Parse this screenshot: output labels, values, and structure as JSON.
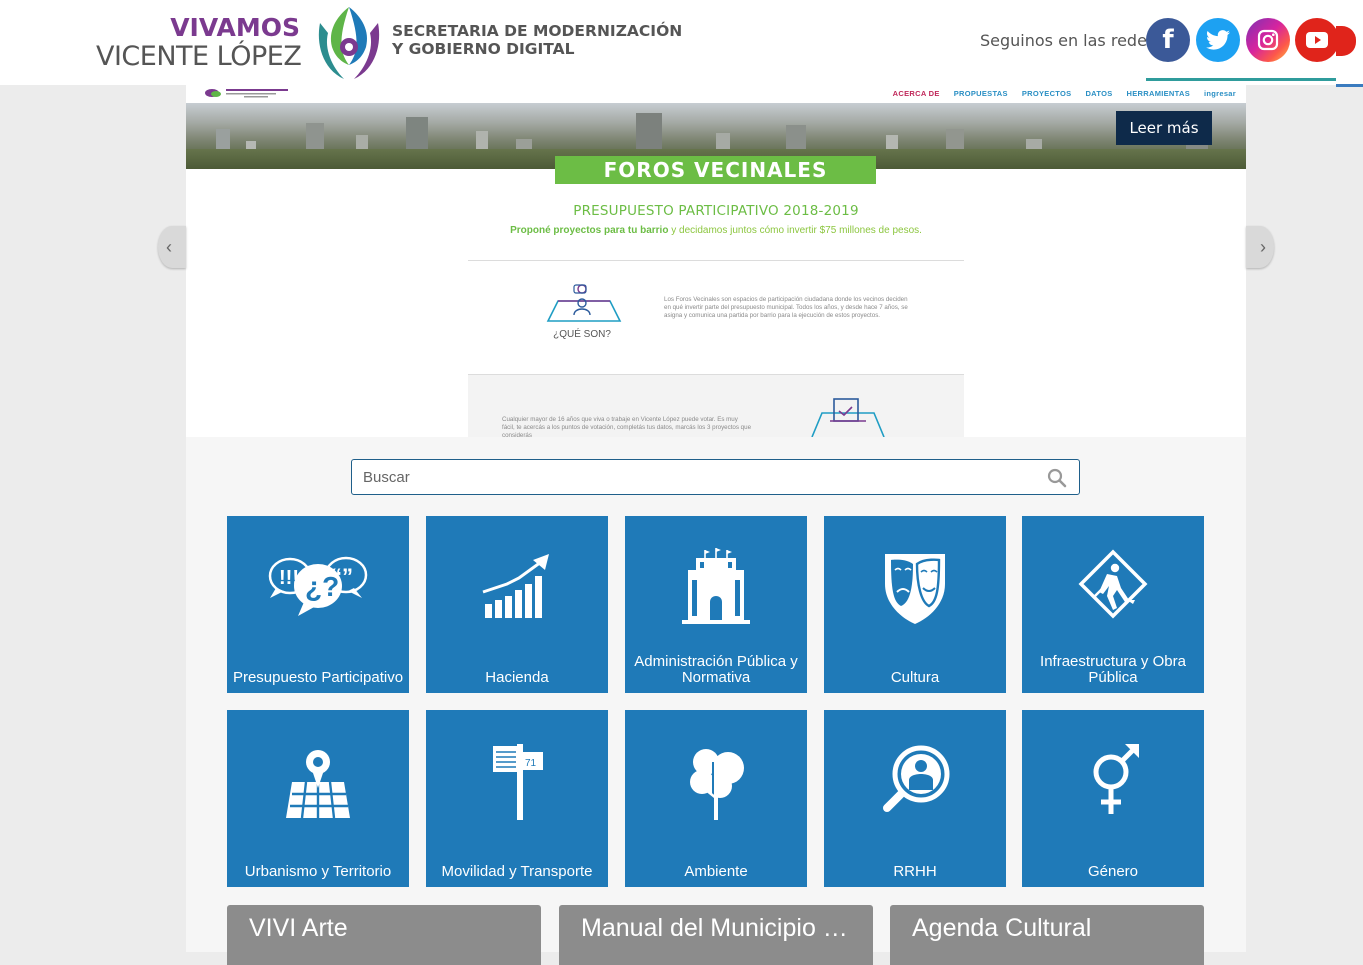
{
  "header": {
    "logo_line1": "VIVAMOS",
    "logo_line2": "VICENTE LÓPEZ",
    "secretaria_line1": "SECRETARIA DE MODERNIZACIÓN",
    "secretaria_line2": "Y GOBIERNO DIGITAL",
    "redes_label": "Seguinos en las redes",
    "social": [
      {
        "name": "facebook",
        "icon": "facebook-icon",
        "color": "#3b5998"
      },
      {
        "name": "twitter",
        "icon": "twitter-icon",
        "color": "#1da1f2"
      },
      {
        "name": "instagram",
        "icon": "instagram-icon",
        "color": "#d6249f"
      },
      {
        "name": "youtube",
        "icon": "youtube-icon",
        "color": "#e0241b"
      }
    ]
  },
  "carousel": {
    "mini_nav": [
      "ACERCA DE",
      "PROPUESTAS",
      "PROYECTOS",
      "DATOS",
      "HERRAMIENTAS",
      "ingresar"
    ],
    "leer_mas": "Leer más",
    "banner_title": "FOROS VECINALES",
    "headline": "PRESUPUESTO PARTICIPATIVO 2018-2019",
    "sub_bold": "Proponé proyectos para tu barrio",
    "sub_rest": " y decidamos juntos cómo invertir $75 millones de pesos.",
    "que_son_label": "¿QUÉ SON?",
    "que_son_text": "Los Foros Vecinales son espacios de participación ciudadana donde los vecinos deciden en qué invertir parte del presupuesto municipal. Todos los años, y desde hace 7 años, se asigna y comunica una partida por barrio para la ejecución de estos proyectos.",
    "voto_text": "Cualquier mayor de 16 años que viva o trabaje en Vicente López puede votar. Es muy fácil, te acercás a los puntos de votación, completás tus datos, marcás los 3 proyectos que considerás"
  },
  "search": {
    "placeholder": "Buscar"
  },
  "tiles": [
    {
      "label": "Presupuesto Participativo",
      "icon": "speech-bubbles-icon"
    },
    {
      "label": "Hacienda",
      "icon": "growth-chart-icon"
    },
    {
      "label": "Administración Pública y Normativa",
      "icon": "government-building-icon"
    },
    {
      "label": "Cultura",
      "icon": "theater-masks-icon"
    },
    {
      "label": "Infraestructura y Obra Pública",
      "icon": "road-work-sign-icon"
    },
    {
      "label": "Urbanismo y Territorio",
      "icon": "map-pin-icon"
    },
    {
      "label": "Movilidad y Transporte",
      "icon": "street-sign-icon"
    },
    {
      "label": "Ambiente",
      "icon": "tree-icon"
    },
    {
      "label": "RRHH",
      "icon": "person-magnifier-icon"
    },
    {
      "label": "Género",
      "icon": "gender-symbol-icon"
    }
  ],
  "bottom_cards": [
    {
      "label": "VIVI Arte"
    },
    {
      "label": "Manual del Municipio de Vicente López"
    },
    {
      "label": "Agenda Cultural"
    }
  ],
  "colors": {
    "tile_blue": "#1f7ab8",
    "brand_purple": "#7b3a8f",
    "foros_green": "#6cbd45",
    "card_gray": "#8c8c8c"
  }
}
